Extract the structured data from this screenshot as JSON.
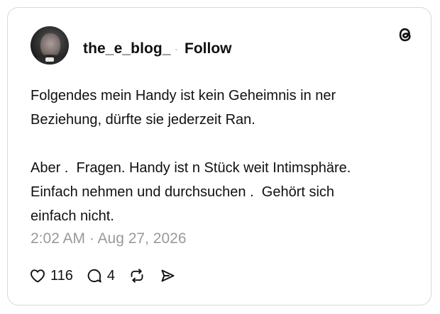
{
  "author": {
    "username": "the_e_blog_",
    "separator": "·",
    "follow_label": "Follow"
  },
  "post": {
    "paragraph_1": "Folgendes mein Handy ist kein Geheimnis in ner\nBeziehung, dürfte sie jederzeit Ran.",
    "paragraph_2": "Aber .  Fragen. Handy ist n Stück weit Intimsphäre.\nEinfach nehmen und durchsuchen .  Gehört sich\neinfach nicht.",
    "timestamp": "2:02 AM · Aug 27, 2026"
  },
  "actions": {
    "likes": "116",
    "replies": "4"
  },
  "icons": {
    "logo": "threads-logo-icon",
    "like": "heart-icon",
    "reply": "comment-icon",
    "repost": "repost-icon",
    "share": "send-icon"
  },
  "colors": {
    "text": "#101010",
    "muted": "#999999",
    "border": "#d9d9d9"
  }
}
